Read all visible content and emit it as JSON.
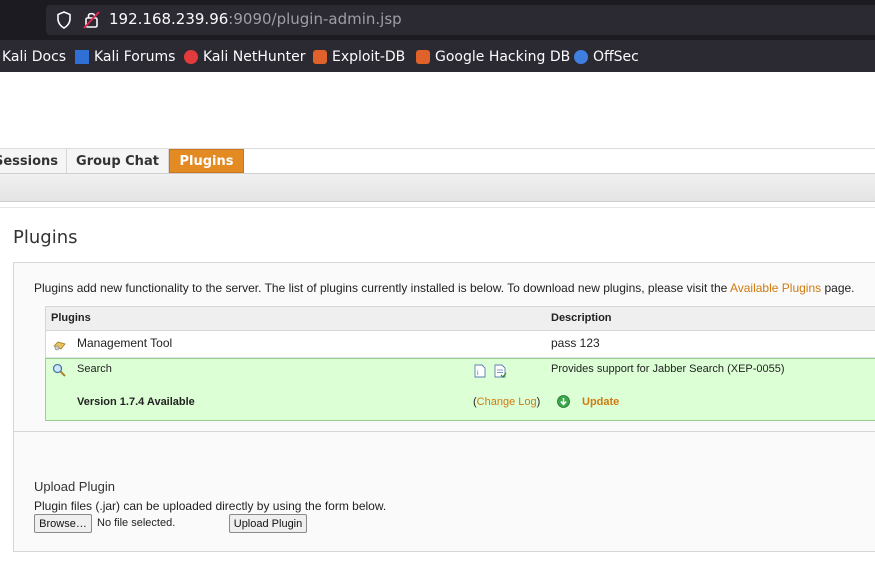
{
  "browser": {
    "url_host": "192.168.239.96",
    "url_rest": ":9090/plugin-admin.jsp",
    "bookmarks": [
      "Kali Docs",
      "Kali Forums",
      "Kali NetHunter",
      "Exploit-DB",
      "Google Hacking DB",
      "OffSec"
    ]
  },
  "tabs": [
    "Sessions",
    "Group Chat",
    "Plugins"
  ],
  "page": {
    "title": "Plugins",
    "intro_text": "Plugins add new functionality to the server. The list of plugins currently installed is below. To download new plugins, please visit the ",
    "intro_link": "Available Plugins",
    "intro_end": " page."
  },
  "table": {
    "headers": [
      "Plugins",
      "Description"
    ],
    "rows": [
      {
        "name": "Management Tool",
        "description": "pass 123"
      },
      {
        "name": "Search",
        "description": "Provides support for Jabber Search (XEP-0055)"
      }
    ],
    "update": {
      "version_text": "Version 1.7.4 Available",
      "paren_open": "(",
      "changelog": "Change Log",
      "paren_close": ")",
      "update_label": "Update"
    }
  },
  "upload": {
    "title": "Upload Plugin",
    "desc": "Plugin files (.jar) can be uploaded directly by using the form below.",
    "browse": "Browse…",
    "nofile": "No file selected.",
    "button": "Upload Plugin"
  }
}
